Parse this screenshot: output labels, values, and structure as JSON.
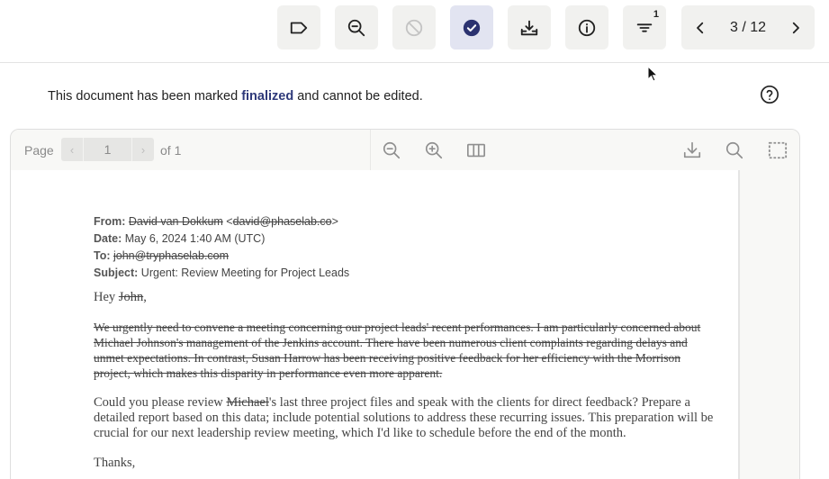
{
  "toolbar": {
    "buttons": [
      {
        "name": "tag",
        "icon": "tag-icon"
      },
      {
        "name": "zoom-search",
        "icon": "zoom-search-icon"
      },
      {
        "name": "block",
        "icon": "block-icon",
        "state": "disabled"
      },
      {
        "name": "finalize",
        "icon": "check-circle-icon",
        "state": "active"
      },
      {
        "name": "download",
        "icon": "download-tray-icon"
      },
      {
        "name": "info",
        "icon": "info-icon"
      },
      {
        "name": "filter",
        "icon": "filter-icon",
        "badge": "1"
      }
    ],
    "pager": {
      "text": "3 / 12"
    }
  },
  "notice": {
    "prefix": "This document has been marked ",
    "highlight": "finalized",
    "suffix": " and cannot be edited."
  },
  "viewer": {
    "page_label": "Page",
    "page_value": "1",
    "of_label": "of 1"
  },
  "email": {
    "from_label": "From:",
    "from_name": "David van Dokkum",
    "from_email_open": " <",
    "from_email": "david@phaselab.co",
    "from_email_close": ">",
    "date_label": "Date:",
    "date_value": "May 6, 2024 1:40 AM (UTC)",
    "to_label": "To:",
    "to_value": "john@tryphaselab.com",
    "subject_label": "Subject:",
    "subject_value": "Urgent: Review Meeting for Project Leads",
    "greeting_prefix": "Hey ",
    "greeting_name": "John",
    "greeting_suffix": ",",
    "paragraph1": "We urgently need to convene a meeting concerning our project leads' recent performances. I am particularly concerned about Michael Johnson's management of the Jenkins account. There have been numerous client complaints regarding delays and unmet expectations. In contrast, Susan Harrow has been receiving positive feedback for her efficiency with the Morrison project, which makes this disparity in performance even more apparent.",
    "paragraph2_prefix": "Could you please review ",
    "paragraph2_name": "Michael",
    "paragraph2_suffix": "'s last three project files and speak with the clients for direct feedback? Prepare a detailed report based on this data; include potential solutions to address these recurring issues. This preparation will be crucial for our next leadership review meeting, which I'd like to schedule before the end of the month.",
    "closing": "Thanks,"
  },
  "colors": {
    "accent": "#2f3a7a",
    "button_bg": "#f1f1ef",
    "active_bg": "#e2e4f1"
  }
}
